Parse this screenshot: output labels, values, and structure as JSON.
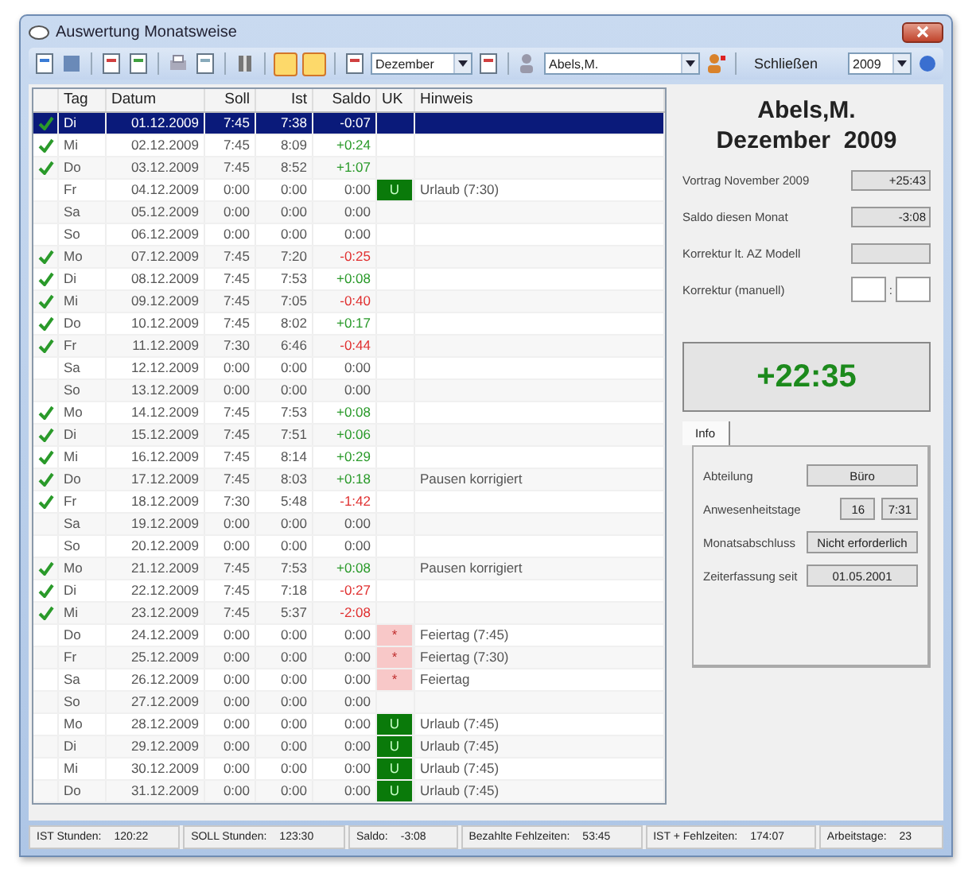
{
  "window": {
    "title": "Auswertung Monatsweise"
  },
  "toolbar": {
    "month": "Dezember",
    "employee": "Abels,M.",
    "close_label": "Schließen",
    "year": "2009",
    "view_buttons": [
      {
        "selected": true
      },
      {
        "selected": true
      }
    ]
  },
  "table": {
    "columns": [
      "Tag",
      "Datum",
      "Soll",
      "Ist",
      "Saldo",
      "UK",
      "Hinweis"
    ],
    "rows": [
      {
        "checked": true,
        "selected": true,
        "day": "Di",
        "date": "01.12.2009",
        "soll": "7:45",
        "ist": "7:38",
        "saldo": "-0:07",
        "uk": "",
        "hint": ""
      },
      {
        "checked": true,
        "selected": false,
        "day": "Mi",
        "date": "02.12.2009",
        "soll": "7:45",
        "ist": "8:09",
        "saldo": "+0:24",
        "uk": "",
        "hint": ""
      },
      {
        "checked": true,
        "selected": false,
        "day": "Do",
        "date": "03.12.2009",
        "soll": "7:45",
        "ist": "8:52",
        "saldo": "+1:07",
        "uk": "",
        "hint": ""
      },
      {
        "checked": false,
        "selected": false,
        "day": "Fr",
        "date": "04.12.2009",
        "soll": "0:00",
        "ist": "0:00",
        "saldo": "0:00",
        "uk": {
          "code": "U",
          "color": "#0a7a0a"
        },
        "hint": "Urlaub (7:30)"
      },
      {
        "checked": false,
        "selected": false,
        "day": "Sa",
        "date": "05.12.2009",
        "soll": "0:00",
        "ist": "0:00",
        "saldo": "0:00",
        "uk": "",
        "hint": ""
      },
      {
        "checked": false,
        "selected": false,
        "day": "So",
        "date": "06.12.2009",
        "soll": "0:00",
        "ist": "0:00",
        "saldo": "0:00",
        "uk": "",
        "hint": ""
      },
      {
        "checked": true,
        "selected": false,
        "day": "Mo",
        "date": "07.12.2009",
        "soll": "7:45",
        "ist": "7:20",
        "saldo": "-0:25",
        "uk": "",
        "hint": ""
      },
      {
        "checked": true,
        "selected": false,
        "day": "Di",
        "date": "08.12.2009",
        "soll": "7:45",
        "ist": "7:53",
        "saldo": "+0:08",
        "uk": "",
        "hint": ""
      },
      {
        "checked": true,
        "selected": false,
        "day": "Mi",
        "date": "09.12.2009",
        "soll": "7:45",
        "ist": "7:05",
        "saldo": "-0:40",
        "uk": "",
        "hint": ""
      },
      {
        "checked": true,
        "selected": false,
        "day": "Do",
        "date": "10.12.2009",
        "soll": "7:45",
        "ist": "8:02",
        "saldo": "+0:17",
        "uk": "",
        "hint": ""
      },
      {
        "checked": true,
        "selected": false,
        "day": "Fr",
        "date": "11.12.2009",
        "soll": "7:30",
        "ist": "6:46",
        "saldo": "-0:44",
        "uk": "",
        "hint": ""
      },
      {
        "checked": false,
        "selected": false,
        "day": "Sa",
        "date": "12.12.2009",
        "soll": "0:00",
        "ist": "0:00",
        "saldo": "0:00",
        "uk": "",
        "hint": ""
      },
      {
        "checked": false,
        "selected": false,
        "day": "So",
        "date": "13.12.2009",
        "soll": "0:00",
        "ist": "0:00",
        "saldo": "0:00",
        "uk": "",
        "hint": ""
      },
      {
        "checked": true,
        "selected": false,
        "day": "Mo",
        "date": "14.12.2009",
        "soll": "7:45",
        "ist": "7:53",
        "saldo": "+0:08",
        "uk": "",
        "hint": ""
      },
      {
        "checked": true,
        "selected": false,
        "day": "Di",
        "date": "15.12.2009",
        "soll": "7:45",
        "ist": "7:51",
        "saldo": "+0:06",
        "uk": "",
        "hint": ""
      },
      {
        "checked": true,
        "selected": false,
        "day": "Mi",
        "date": "16.12.2009",
        "soll": "7:45",
        "ist": "8:14",
        "saldo": "+0:29",
        "uk": "",
        "hint": ""
      },
      {
        "checked": true,
        "selected": false,
        "day": "Do",
        "date": "17.12.2009",
        "soll": "7:45",
        "ist": "8:03",
        "saldo": "+0:18",
        "uk": "",
        "hint": "Pausen korrigiert"
      },
      {
        "checked": true,
        "selected": false,
        "day": "Fr",
        "date": "18.12.2009",
        "soll": "7:30",
        "ist": "5:48",
        "saldo": "-1:42",
        "uk": "",
        "hint": ""
      },
      {
        "checked": false,
        "selected": false,
        "day": "Sa",
        "date": "19.12.2009",
        "soll": "0:00",
        "ist": "0:00",
        "saldo": "0:00",
        "uk": "",
        "hint": ""
      },
      {
        "checked": false,
        "selected": false,
        "day": "So",
        "date": "20.12.2009",
        "soll": "0:00",
        "ist": "0:00",
        "saldo": "0:00",
        "uk": "",
        "hint": ""
      },
      {
        "checked": true,
        "selected": false,
        "day": "Mo",
        "date": "21.12.2009",
        "soll": "7:45",
        "ist": "7:53",
        "saldo": "+0:08",
        "uk": "",
        "hint": "Pausen korrigiert"
      },
      {
        "checked": true,
        "selected": false,
        "day": "Di",
        "date": "22.12.2009",
        "soll": "7:45",
        "ist": "7:18",
        "saldo": "-0:27",
        "uk": "",
        "hint": ""
      },
      {
        "checked": true,
        "selected": false,
        "day": "Mi",
        "date": "23.12.2009",
        "soll": "7:45",
        "ist": "5:37",
        "saldo": "-2:08",
        "uk": "",
        "hint": ""
      },
      {
        "checked": false,
        "selected": false,
        "day": "Do",
        "date": "24.12.2009",
        "soll": "0:00",
        "ist": "0:00",
        "saldo": "0:00",
        "uk": {
          "code": "*",
          "color": "#f8c8c8"
        },
        "hint": "Feiertag (7:45)"
      },
      {
        "checked": false,
        "selected": false,
        "day": "Fr",
        "date": "25.12.2009",
        "soll": "0:00",
        "ist": "0:00",
        "saldo": "0:00",
        "uk": {
          "code": "*",
          "color": "#f8c8c8"
        },
        "hint": "Feiertag (7:30)"
      },
      {
        "checked": false,
        "selected": false,
        "day": "Sa",
        "date": "26.12.2009",
        "soll": "0:00",
        "ist": "0:00",
        "saldo": "0:00",
        "uk": {
          "code": "*",
          "color": "#f8c8c8"
        },
        "hint": "Feiertag"
      },
      {
        "checked": false,
        "selected": false,
        "day": "So",
        "date": "27.12.2009",
        "soll": "0:00",
        "ist": "0:00",
        "saldo": "0:00",
        "uk": "",
        "hint": ""
      },
      {
        "checked": false,
        "selected": false,
        "day": "Mo",
        "date": "28.12.2009",
        "soll": "0:00",
        "ist": "0:00",
        "saldo": "0:00",
        "uk": {
          "code": "U",
          "color": "#0a7a0a"
        },
        "hint": "Urlaub (7:45)"
      },
      {
        "checked": false,
        "selected": false,
        "day": "Di",
        "date": "29.12.2009",
        "soll": "0:00",
        "ist": "0:00",
        "saldo": "0:00",
        "uk": {
          "code": "U",
          "color": "#0a7a0a"
        },
        "hint": "Urlaub (7:45)"
      },
      {
        "checked": false,
        "selected": false,
        "day": "Mi",
        "date": "30.12.2009",
        "soll": "0:00",
        "ist": "0:00",
        "saldo": "0:00",
        "uk": {
          "code": "U",
          "color": "#0a7a0a"
        },
        "hint": "Urlaub (7:45)"
      },
      {
        "checked": false,
        "selected": false,
        "day": "Do",
        "date": "31.12.2009",
        "soll": "0:00",
        "ist": "0:00",
        "saldo": "0:00",
        "uk": {
          "code": "U",
          "color": "#0a7a0a"
        },
        "hint": "Urlaub (7:45)"
      }
    ]
  },
  "summary": {
    "name": "Abels,M.",
    "period": "Dezember  2009",
    "fields": [
      {
        "label": "Vortrag November 2009",
        "value": "+25:43",
        "kind": "readonly"
      },
      {
        "label": "Saldo diesen Monat",
        "value": "-3:08",
        "kind": "readonly"
      },
      {
        "label": "Korrektur lt. AZ Modell",
        "kind": "readonly"
      },
      {
        "label": "Korrektur (manuell)",
        "separator": ":",
        "kind": "time"
      }
    ],
    "total": "+22:35",
    "tab": "Info",
    "info": [
      {
        "label": "Abteilung",
        "values": [
          "Büro"
        ]
      },
      {
        "label": "Anwesenheitstage",
        "values": [
          "16",
          "7:31"
        ]
      },
      {
        "label": "Monatsabschluss",
        "values": [
          "Nicht erforderlich"
        ]
      },
      {
        "label": "Zeiterfassung seit",
        "values": [
          "01.05.2001"
        ]
      }
    ]
  },
  "status_bar": [
    {
      "label": "IST Stunden:",
      "value": "120:22"
    },
    {
      "label": "SOLL Stunden:",
      "value": "123:30"
    },
    {
      "label": "Saldo:",
      "value": "-3:08"
    },
    {
      "label": "Bezahlte Fehlzeiten:",
      "value": "53:45"
    },
    {
      "label": "IST + Fehlzeiten:",
      "value": "174:07"
    },
    {
      "label": "Arbeitstage:",
      "value": "23"
    }
  ]
}
